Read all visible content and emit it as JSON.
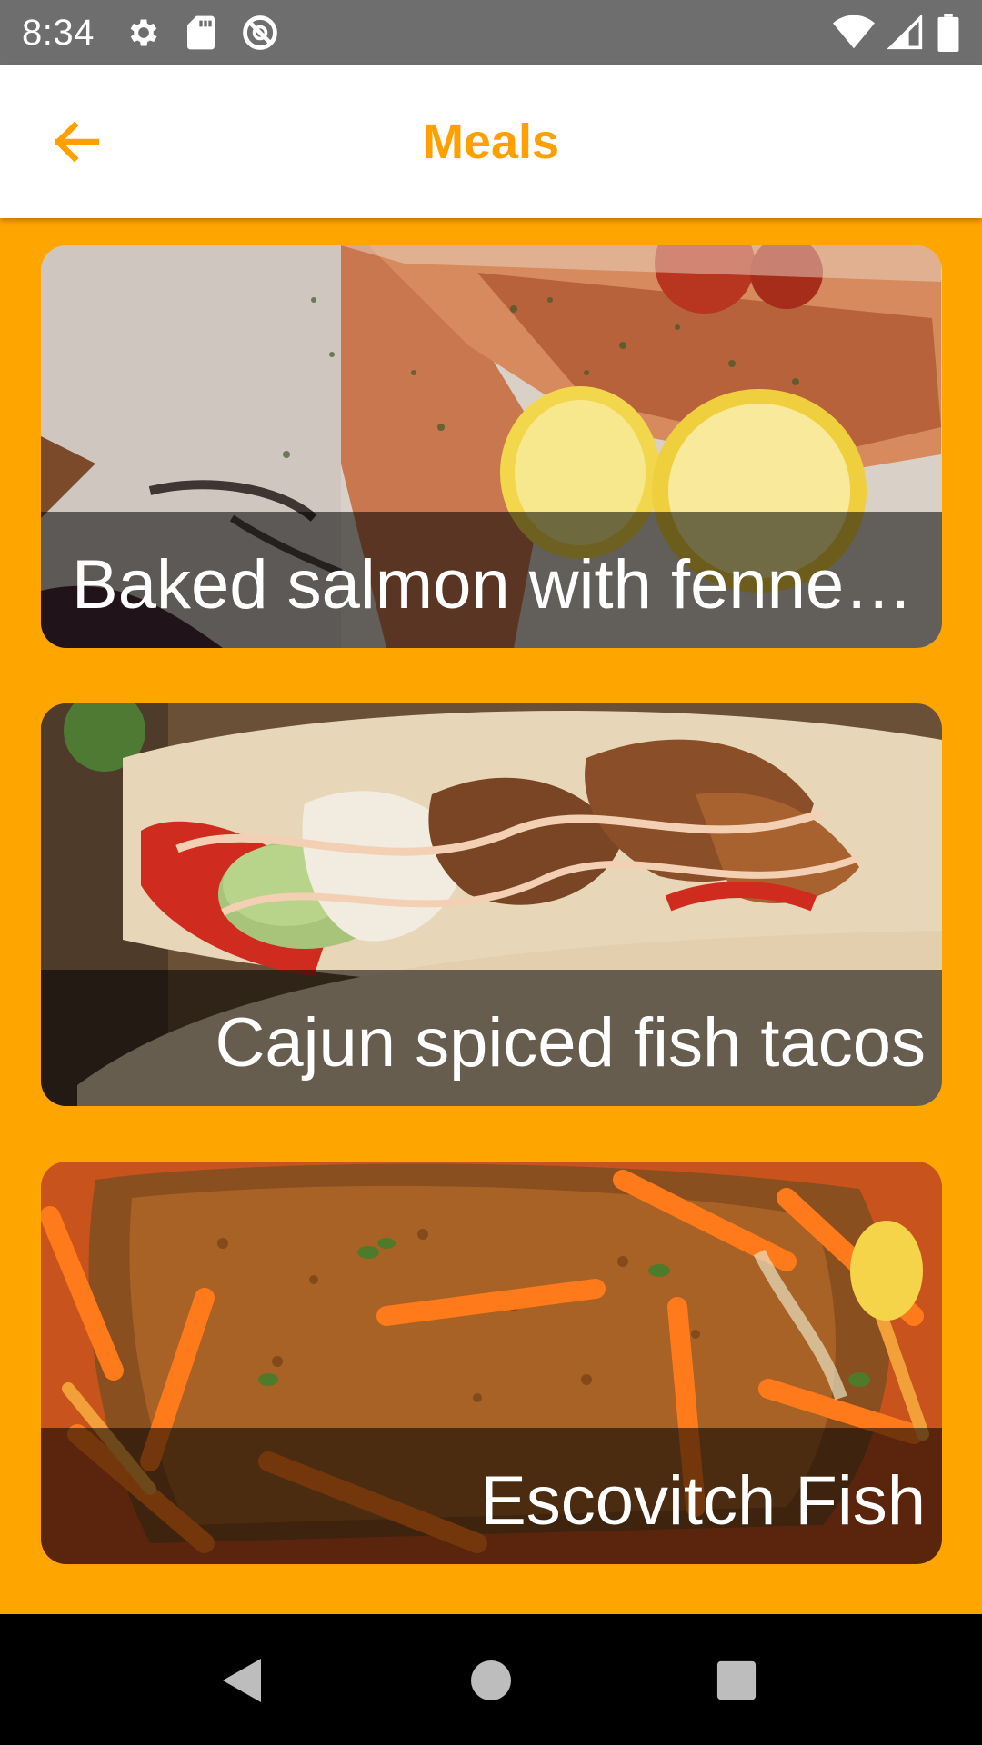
{
  "status_bar": {
    "time": "8:34",
    "left_icons": [
      "settings-gear-icon",
      "sd-card-icon",
      "do-not-disturb-icon"
    ],
    "right_icons": [
      "wifi-icon",
      "cell-signal-icon",
      "battery-icon"
    ],
    "background": "#6e6e6e"
  },
  "app_bar": {
    "title": "Meals",
    "back_icon": "arrow-back-icon",
    "title_color": "#FFA000"
  },
  "content": {
    "background": "#FFA500",
    "meals": [
      {
        "name": "Baked salmon with fennel…",
        "image_subject": "baked salmon with lemon and dill"
      },
      {
        "name": "Cajun spiced fish tacos",
        "image_subject": "fish tacos with avocado and sauce"
      },
      {
        "name": "Escovitch Fish",
        "image_subject": "fried fish with carrots and peppers"
      }
    ]
  },
  "nav_bar": {
    "buttons": [
      "back-triangle-icon",
      "home-circle-icon",
      "recents-square-icon"
    ]
  }
}
